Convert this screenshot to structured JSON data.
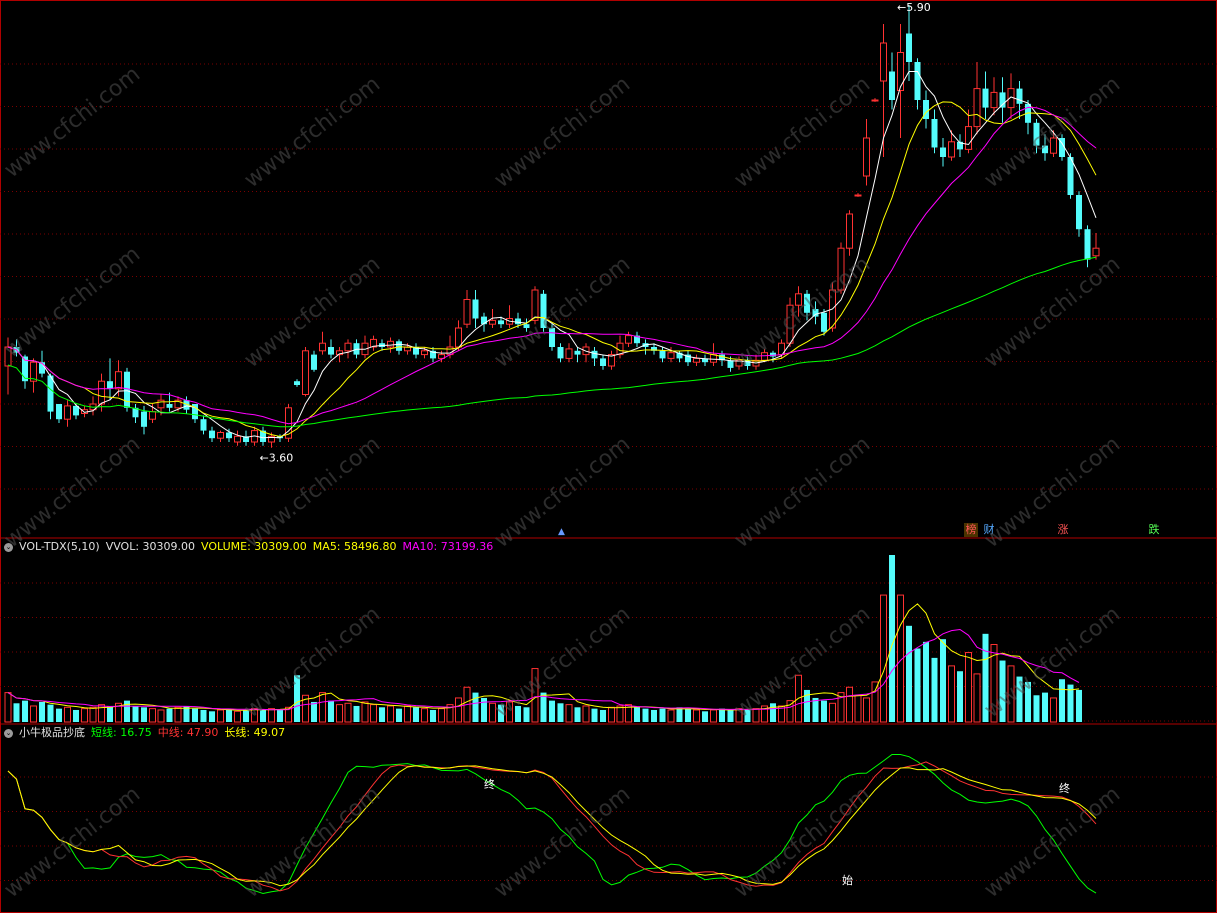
{
  "price_panel": {
    "high_label": "5.90",
    "low_label": "3.60",
    "tags": [
      {
        "text": "榜",
        "color": "#ff5555",
        "bg": "#4a3300"
      },
      {
        "text": "财",
        "color": "#55aaff",
        "bg": ""
      },
      {
        "text": "涨",
        "color": "#ff5555",
        "bg": ""
      },
      {
        "text": "跌",
        "color": "#55ff55",
        "bg": ""
      }
    ],
    "marker_symbol": "▲"
  },
  "vol_panel": {
    "name": "VOL-TDX(5,10)",
    "vvol": "VVOL: 30309.00",
    "volume": "VOLUME: 30309.00",
    "ma5": "MA5: 58496.80",
    "ma10": "MA10: 73199.36"
  },
  "ind_panel": {
    "name": "小牛极品抄底",
    "short": "短线: 16.75",
    "mid": "中线: 47.90",
    "long": "长线: 49.07",
    "marks": [
      "终",
      "始",
      "终"
    ]
  },
  "watermark": "www.cfchi.com",
  "colors": {
    "up": "#ff3232",
    "down": "#54fcfc",
    "ma_white": "#ffffff",
    "ma_yellow": "#ffff00",
    "ma_magenta": "#ff00ff",
    "ma_green": "#00ff00",
    "grid": "#7a0000"
  },
  "chart_data": {
    "type": "candlestick",
    "candles": [
      [
        4.0,
        4.1,
        3.85,
        4.15
      ],
      [
        4.1,
        4.07,
        4.05,
        4.14
      ],
      [
        4.05,
        3.92,
        3.88,
        4.06
      ],
      [
        3.92,
        4.02,
        3.86,
        4.04
      ],
      [
        4.02,
        3.96,
        3.94,
        4.08
      ],
      [
        3.95,
        3.76,
        3.72,
        3.96
      ],
      [
        3.8,
        3.72,
        3.7,
        3.8
      ],
      [
        3.72,
        3.79,
        3.68,
        3.82
      ],
      [
        3.79,
        3.74,
        3.72,
        3.8
      ],
      [
        3.75,
        3.77,
        3.73,
        3.79
      ],
      [
        3.77,
        3.8,
        3.74,
        3.84
      ],
      [
        3.8,
        3.92,
        3.76,
        3.96
      ],
      [
        3.92,
        3.88,
        3.82,
        4.04
      ],
      [
        3.88,
        3.97,
        3.84,
        4.03
      ],
      [
        3.97,
        3.78,
        3.76,
        3.99
      ],
      [
        3.78,
        3.73,
        3.7,
        3.8
      ],
      [
        3.76,
        3.68,
        3.64,
        3.79
      ],
      [
        3.72,
        3.76,
        3.7,
        3.8
      ],
      [
        3.78,
        3.82,
        3.74,
        3.85
      ],
      [
        3.8,
        3.78,
        3.76,
        3.86
      ],
      [
        3.78,
        3.82,
        3.76,
        3.84
      ],
      [
        3.82,
        3.77,
        3.75,
        3.84
      ],
      [
        3.8,
        3.72,
        3.7,
        3.8
      ],
      [
        3.72,
        3.66,
        3.64,
        3.74
      ],
      [
        3.66,
        3.62,
        3.6,
        3.68
      ],
      [
        3.62,
        3.65,
        3.6,
        3.66
      ],
      [
        3.65,
        3.62,
        3.6,
        3.67
      ],
      [
        3.6,
        3.63,
        3.58,
        3.66
      ],
      [
        3.63,
        3.6,
        3.58,
        3.66
      ],
      [
        3.6,
        3.66,
        3.58,
        3.68
      ],
      [
        3.66,
        3.6,
        3.58,
        3.68
      ],
      [
        3.6,
        3.63,
        3.57,
        3.65
      ],
      [
        3.63,
        3.62,
        3.6,
        3.64
      ],
      [
        3.62,
        3.78,
        3.6,
        3.8
      ],
      [
        3.92,
        3.9,
        3.89,
        3.93
      ],
      [
        3.85,
        4.08,
        3.84,
        4.1
      ],
      [
        4.06,
        3.98,
        3.97,
        4.08
      ],
      [
        4.08,
        4.12,
        4.06,
        4.18
      ],
      [
        4.1,
        4.06,
        4.04,
        4.14
      ],
      [
        4.06,
        4.08,
        4.02,
        4.1
      ],
      [
        4.08,
        4.12,
        4.04,
        4.14
      ],
      [
        4.12,
        4.06,
        4.04,
        4.14
      ],
      [
        4.06,
        4.12,
        4.04,
        4.16
      ],
      [
        4.1,
        4.14,
        4.08,
        4.16
      ],
      [
        4.12,
        4.1,
        4.08,
        4.14
      ],
      [
        4.1,
        4.13,
        4.07,
        4.15
      ],
      [
        4.13,
        4.08,
        4.06,
        4.14
      ],
      [
        4.08,
        4.1,
        4.06,
        4.12
      ],
      [
        4.1,
        4.06,
        4.04,
        4.12
      ],
      [
        4.06,
        4.08,
        4.04,
        4.1
      ],
      [
        4.08,
        4.04,
        4.02,
        4.1
      ],
      [
        4.04,
        4.06,
        4.02,
        4.08
      ],
      [
        4.06,
        4.1,
        4.04,
        4.16
      ],
      [
        4.1,
        4.2,
        4.08,
        4.24
      ],
      [
        4.22,
        4.35,
        4.2,
        4.4
      ],
      [
        4.35,
        4.25,
        4.2,
        4.4
      ],
      [
        4.26,
        4.22,
        4.18,
        4.28
      ],
      [
        4.22,
        4.24,
        4.2,
        4.3
      ],
      [
        4.24,
        4.22,
        4.2,
        4.26
      ],
      [
        4.22,
        4.25,
        4.2,
        4.32
      ],
      [
        4.25,
        4.22,
        4.2,
        4.28
      ],
      [
        4.22,
        4.2,
        4.18,
        4.25
      ],
      [
        4.24,
        4.4,
        4.22,
        4.42
      ],
      [
        4.38,
        4.2,
        4.18,
        4.4
      ],
      [
        4.2,
        4.1,
        4.08,
        4.22
      ],
      [
        4.1,
        4.04,
        4.02,
        4.12
      ],
      [
        4.04,
        4.09,
        4.02,
        4.12
      ],
      [
        4.08,
        4.06,
        4.02,
        4.1
      ],
      [
        4.06,
        4.1,
        4.02,
        4.12
      ],
      [
        4.08,
        4.04,
        4.0,
        4.1
      ],
      [
        4.04,
        4.0,
        3.98,
        4.06
      ],
      [
        4.0,
        4.06,
        3.98,
        4.08
      ],
      [
        4.06,
        4.12,
        4.04,
        4.16
      ],
      [
        4.12,
        4.16,
        4.1,
        4.18
      ],
      [
        4.16,
        4.12,
        4.1,
        4.18
      ],
      [
        4.12,
        4.1,
        4.06,
        4.14
      ],
      [
        4.1,
        4.08,
        4.06,
        4.12
      ],
      [
        4.08,
        4.04,
        4.02,
        4.1
      ],
      [
        4.04,
        4.07,
        4.02,
        4.1
      ],
      [
        4.07,
        4.04,
        4.02,
        4.08
      ],
      [
        4.06,
        4.02,
        4.0,
        4.08
      ],
      [
        4.02,
        4.04,
        4.0,
        4.06
      ],
      [
        4.04,
        4.02,
        4.0,
        4.06
      ],
      [
        4.02,
        4.06,
        4.0,
        4.12
      ],
      [
        4.06,
        4.03,
        4.0,
        4.08
      ],
      [
        4.03,
        3.99,
        3.97,
        4.05
      ],
      [
        4.0,
        4.03,
        3.98,
        4.05
      ],
      [
        4.03,
        4.0,
        3.98,
        4.05
      ],
      [
        4.0,
        4.03,
        3.98,
        4.06
      ],
      [
        4.03,
        4.07,
        4.02,
        4.09
      ],
      [
        4.07,
        4.05,
        4.02,
        4.08
      ],
      [
        4.06,
        4.12,
        4.04,
        4.14
      ],
      [
        4.12,
        4.32,
        4.1,
        4.36
      ],
      [
        4.32,
        4.38,
        4.26,
        4.42
      ],
      [
        4.38,
        4.28,
        4.24,
        4.4
      ],
      [
        4.3,
        4.26,
        4.22,
        4.34
      ],
      [
        4.28,
        4.18,
        4.16,
        4.3
      ],
      [
        4.2,
        4.4,
        4.18,
        4.44
      ],
      [
        4.4,
        4.62,
        4.38,
        4.65
      ],
      [
        4.62,
        4.8,
        4.58,
        4.82
      ],
      [
        4.9,
        4.9,
        4.89,
        4.91
      ],
      [
        5.0,
        5.2,
        4.95,
        5.3
      ],
      [
        5.4,
        5.4,
        5.39,
        5.41
      ],
      [
        5.5,
        5.7,
        5.1,
        5.8
      ],
      [
        5.55,
        5.4,
        5.35,
        5.65
      ],
      [
        5.45,
        5.65,
        5.2,
        5.8
      ],
      [
        5.75,
        5.6,
        5.5,
        5.9
      ],
      [
        5.6,
        5.4,
        5.35,
        5.62
      ],
      [
        5.4,
        5.3,
        5.25,
        5.45
      ],
      [
        5.3,
        5.15,
        5.12,
        5.35
      ],
      [
        5.15,
        5.1,
        5.05,
        5.2
      ],
      [
        5.1,
        5.18,
        5.08,
        5.24
      ],
      [
        5.18,
        5.14,
        5.1,
        5.22
      ],
      [
        5.14,
        5.26,
        5.12,
        5.35
      ],
      [
        5.26,
        5.46,
        5.22,
        5.6
      ],
      [
        5.46,
        5.36,
        5.3,
        5.55
      ],
      [
        5.36,
        5.44,
        5.32,
        5.52
      ],
      [
        5.44,
        5.36,
        5.28,
        5.52
      ],
      [
        5.36,
        5.46,
        5.3,
        5.54
      ],
      [
        5.46,
        5.38,
        5.3,
        5.5
      ],
      [
        5.38,
        5.28,
        5.22,
        5.4
      ],
      [
        5.28,
        5.16,
        5.12,
        5.3
      ],
      [
        5.16,
        5.12,
        5.08,
        5.22
      ],
      [
        5.12,
        5.2,
        5.1,
        5.24
      ],
      [
        5.2,
        5.1,
        5.08,
        5.22
      ],
      [
        5.1,
        4.9,
        4.88,
        5.12
      ],
      [
        4.9,
        4.72,
        4.68,
        4.92
      ],
      [
        4.72,
        4.56,
        4.52,
        4.74
      ],
      [
        4.58,
        4.62,
        4.56,
        4.7
      ]
    ],
    "volume": [
      22,
      14,
      16,
      12,
      15,
      13,
      10,
      11,
      9,
      10,
      11,
      13,
      12,
      14,
      16,
      12,
      11,
      10,
      9,
      10,
      11,
      12,
      10,
      9,
      8,
      9,
      10,
      8,
      9,
      10,
      9,
      10,
      9,
      11,
      35,
      20,
      15,
      22,
      16,
      13,
      14,
      12,
      15,
      13,
      11,
      12,
      10,
      12,
      11,
      10,
      9,
      10,
      13,
      18,
      26,
      22,
      18,
      14,
      13,
      15,
      12,
      11,
      40,
      22,
      16,
      14,
      13,
      11,
      12,
      10,
      9,
      11,
      12,
      13,
      11,
      10,
      9,
      10,
      9,
      11,
      10,
      9,
      8,
      9,
      10,
      9,
      10,
      9,
      10,
      12,
      14,
      12,
      16,
      35,
      24,
      18,
      16,
      14,
      22,
      26,
      20,
      18,
      30,
      95,
      125,
      95,
      72,
      55,
      60,
      48,
      62,
      42,
      38,
      52,
      36,
      66,
      58,
      46,
      42,
      34,
      30,
      20,
      22,
      18,
      32,
      28,
      24
    ]
  }
}
